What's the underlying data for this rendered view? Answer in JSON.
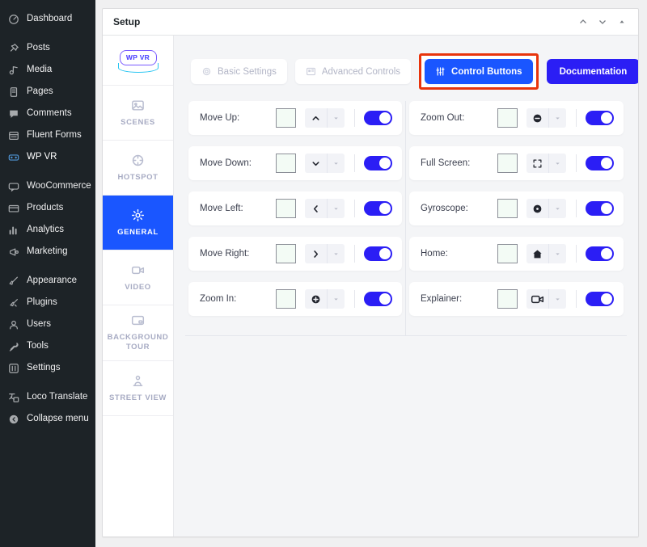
{
  "wp_sidebar": {
    "groups": [
      {
        "items": [
          {
            "label": "Dashboard",
            "icon": "dashboard-icon",
            "active": false
          }
        ]
      },
      {
        "items": [
          {
            "label": "Posts",
            "icon": "pin-icon",
            "active": false
          },
          {
            "label": "Media",
            "icon": "media-icon",
            "active": false
          },
          {
            "label": "Pages",
            "icon": "pages-icon",
            "active": false
          },
          {
            "label": "Comments",
            "icon": "comment-icon",
            "active": false
          },
          {
            "label": "Fluent Forms",
            "icon": "forms-icon",
            "active": false
          },
          {
            "label": "WP VR",
            "icon": "vr-goggles-icon",
            "active": true
          }
        ]
      },
      {
        "items": [
          {
            "label": "WooCommerce",
            "icon": "woocommerce-icon",
            "active": false
          },
          {
            "label": "Products",
            "icon": "products-icon",
            "active": false
          },
          {
            "label": "Analytics",
            "icon": "analytics-icon",
            "active": false
          },
          {
            "label": "Marketing",
            "icon": "megaphone-icon",
            "active": false
          }
        ]
      },
      {
        "items": [
          {
            "label": "Appearance",
            "icon": "brush-icon",
            "active": false
          },
          {
            "label": "Plugins",
            "icon": "plugin-icon",
            "active": false
          },
          {
            "label": "Users",
            "icon": "user-icon",
            "active": false
          },
          {
            "label": "Tools",
            "icon": "wrench-icon",
            "active": false
          },
          {
            "label": "Settings",
            "icon": "settings-sliders-icon",
            "active": false
          }
        ]
      },
      {
        "items": [
          {
            "label": "Loco Translate",
            "icon": "translate-icon",
            "active": false
          },
          {
            "label": "Collapse menu",
            "icon": "collapse-arrow-icon",
            "active": false
          }
        ]
      }
    ]
  },
  "panel": {
    "title": "Setup",
    "header_controls": [
      {
        "name": "move-up-icon",
        "glyph": "chevron-up"
      },
      {
        "name": "move-down-icon",
        "glyph": "chevron-down"
      },
      {
        "name": "toggle-panel-icon",
        "glyph": "triangle-up"
      }
    ]
  },
  "rail": {
    "logo": {
      "text": "WP VR",
      "name": "wpvr-logo"
    },
    "items": [
      {
        "label": "SCENES",
        "icon": "image-icon",
        "active": false
      },
      {
        "label": "HOTSPOT",
        "icon": "hotspot-target-icon",
        "active": false
      },
      {
        "label": "GENERAL",
        "icon": "gear-icon",
        "active": true
      },
      {
        "label": "VIDEO",
        "icon": "video-camera-icon",
        "active": false
      },
      {
        "label": "BACKGROUND TOUR",
        "icon": "background-tour-icon",
        "active": false
      },
      {
        "label": "STREET VIEW",
        "icon": "street-view-icon",
        "active": false
      }
    ]
  },
  "tabs": [
    {
      "label": "Basic Settings",
      "icon": "gear-outline-icon",
      "active": false,
      "highlighted": false
    },
    {
      "label": "Advanced Controls",
      "icon": "panel-icon",
      "active": false,
      "highlighted": false
    },
    {
      "label": "Control Buttons",
      "icon": "sliders-icon",
      "active": true,
      "highlighted": true
    }
  ],
  "documentation_button": {
    "label": "Documentation"
  },
  "controls": {
    "left_column": [
      {
        "label": "Move Up:",
        "swatch_color": "#f3fbf5",
        "icon": "chevron-up-icon",
        "enabled": true
      },
      {
        "label": "Move Down:",
        "swatch_color": "#f3fbf5",
        "icon": "chevron-down-icon",
        "enabled": true
      },
      {
        "label": "Move Left:",
        "swatch_color": "#f3fbf5",
        "icon": "chevron-left-icon",
        "enabled": true
      },
      {
        "label": "Move Right:",
        "swatch_color": "#f3fbf5",
        "icon": "chevron-right-icon",
        "enabled": true
      },
      {
        "label": "Zoom In:",
        "swatch_color": "#f3fbf5",
        "icon": "plus-circle-icon",
        "enabled": true
      }
    ],
    "right_column": [
      {
        "label": "Zoom Out:",
        "swatch_color": "#f3fbf5",
        "icon": "minus-circle-icon",
        "enabled": true
      },
      {
        "label": "Full Screen:",
        "swatch_color": "#f3fbf5",
        "icon": "fullscreen-icon",
        "enabled": true
      },
      {
        "label": "Gyroscope:",
        "swatch_color": "#f3fbf5",
        "icon": "gyroscope-icon",
        "enabled": true
      },
      {
        "label": "Home:",
        "swatch_color": "#f3fbf5",
        "icon": "home-icon",
        "enabled": true
      },
      {
        "label": "Explainer:",
        "swatch_color": "#f3fbf5",
        "icon": "video-camera-icon",
        "enabled": true
      }
    ]
  },
  "colors": {
    "accent_blue": "#1a56ff",
    "button_blue": "#2b1ef5",
    "highlight_red": "#e8340c",
    "sidebar_bg": "#1d2327",
    "content_bg": "#f4f5f7"
  }
}
